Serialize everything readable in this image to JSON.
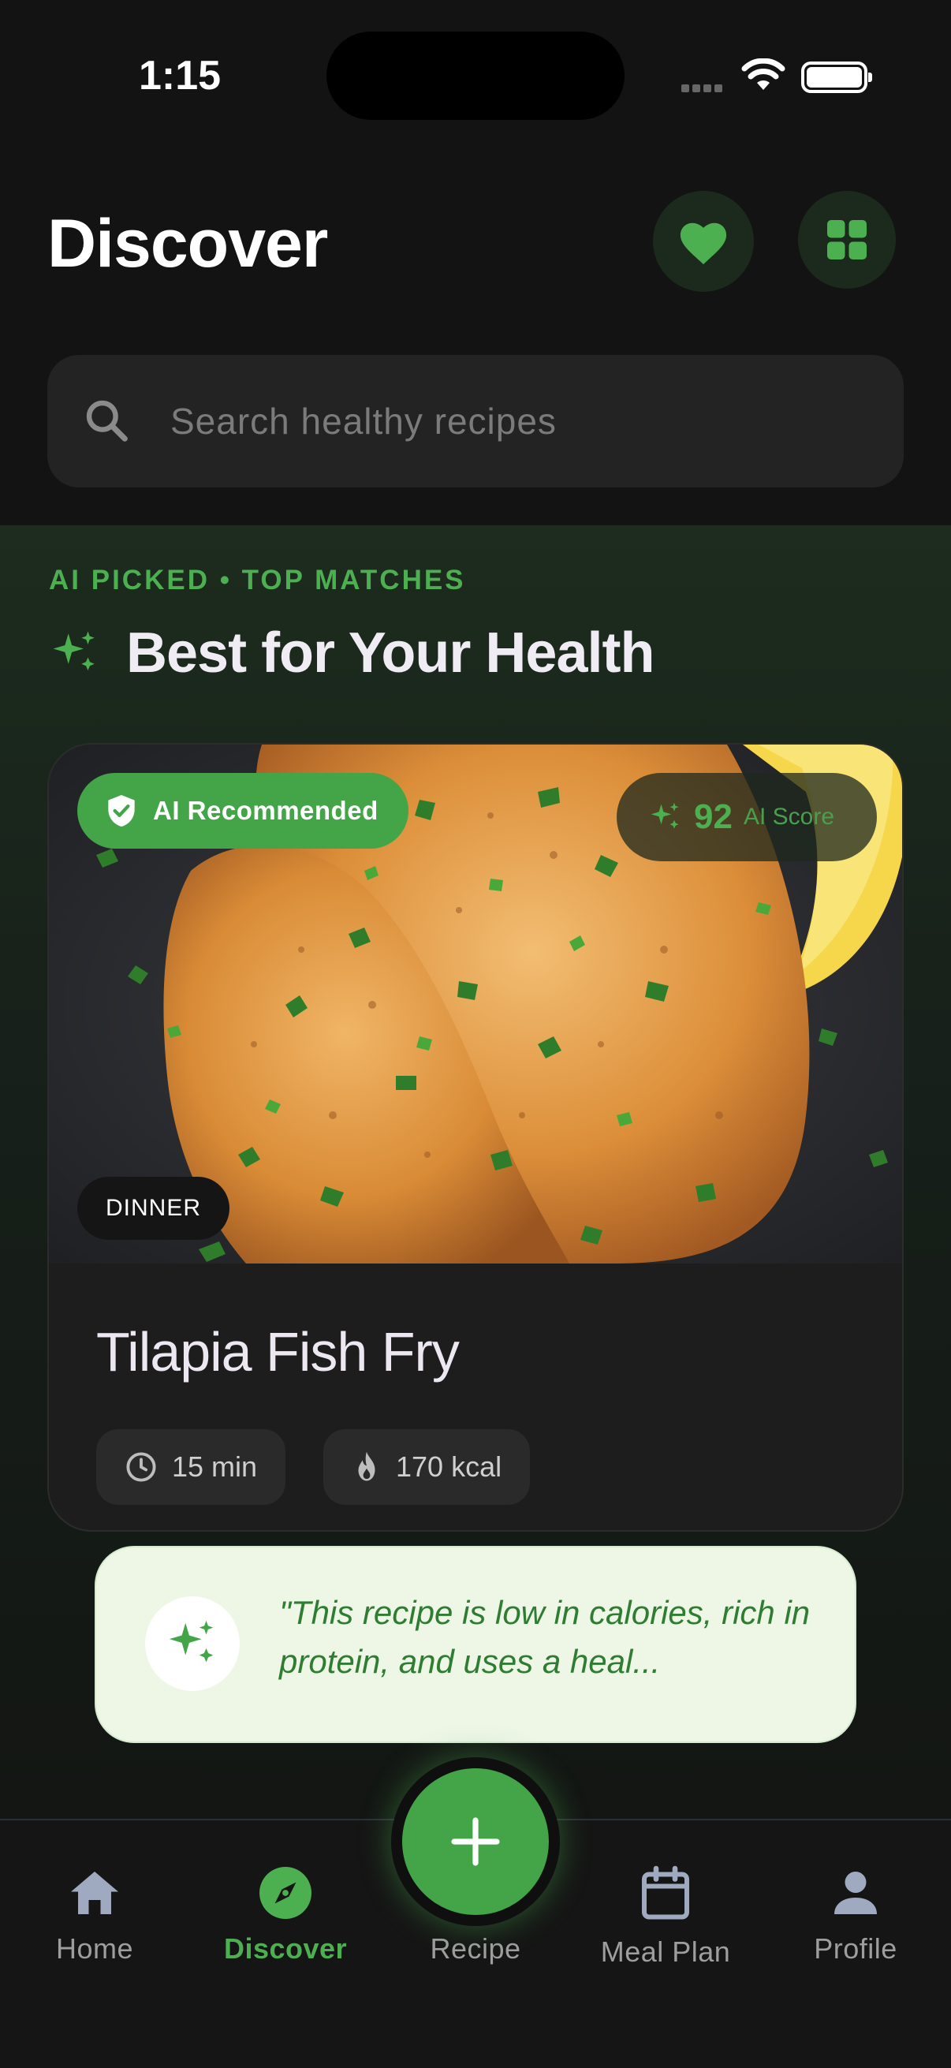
{
  "status_bar": {
    "time": "1:15"
  },
  "header": {
    "title": "Discover",
    "search_placeholder": "Search healthy recipes"
  },
  "section": {
    "kicker": "AI PICKED • TOP MATCHES",
    "title": "Best for Your Health"
  },
  "featured_recipe": {
    "badge": "AI Recommended",
    "ai_score": "92",
    "ai_score_label": "AI Score",
    "meal_type": "DINNER",
    "name": "Tilapia Fish Fry",
    "time": "15 min",
    "calories": "170 kcal",
    "ai_note": "\"This recipe is low in calories, rich in protein, and uses a heal..."
  },
  "bottom_nav": {
    "items": [
      {
        "label": "Home",
        "icon": "home-icon"
      },
      {
        "label": "Discover",
        "icon": "compass-icon",
        "active": true
      },
      {
        "label": "Recipe",
        "icon": "plus-icon"
      },
      {
        "label": "Meal Plan",
        "icon": "calendar-icon"
      },
      {
        "label": "Profile",
        "icon": "person-icon"
      }
    ]
  },
  "colors": {
    "accent": "#4caf50",
    "background": "#131313",
    "card": "#1d1d1d",
    "ai_note_bg": "#eef6e6"
  }
}
